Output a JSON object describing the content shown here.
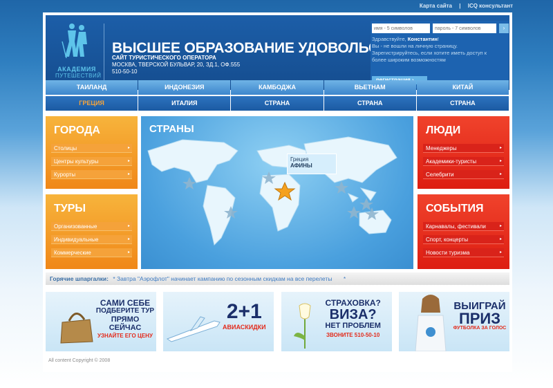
{
  "top_links": {
    "sitemap": "Карта сайта",
    "separator": "|",
    "icq": "ICQ консультант"
  },
  "logo": {
    "line1": "АКАДЕМИЯ",
    "line2": "ПУТЕШЕСТВИЙ"
  },
  "header": {
    "slogan": "ВЫСШЕЕ ОБРАЗОВАНИЕ УДОВОЛЬСТВИЙ",
    "subtitle": "САЙТ ТУРИСТИЧЕСКОГО ОПЕРАТОРА",
    "address": "МОСКВА, ТВЕРСКОЙ БУЛЬВАР, 20, ЗД.1, ОФ.555",
    "phone": "510-50-10"
  },
  "login": {
    "name_placeholder": "имя - 5 символов",
    "password_placeholder": "пароль - 7 символов",
    "go_label": "›",
    "greeting": "Здравствуйте,",
    "user": "Константин",
    "greeting_end": "!",
    "message": "Вы - не вошли на личную страницу. Зарегистрируйтесь, если хотите иметь доступ к более широким возможностям",
    "register_label": "регистрация ›"
  },
  "countries_row1": [
    "ТАИЛАНД",
    "ИНДОНЕЗИЯ",
    "КАМБОДЖА",
    "ВЬЕТНАМ",
    "КИТАЙ"
  ],
  "countries_row2": [
    "ГРЕЦИЯ",
    "ИТАЛИЯ",
    "СТРАНА",
    "СТРАНА",
    "СТРАНА"
  ],
  "cities": {
    "title": "ГОРОДА",
    "items": [
      "Столицы",
      "Центры культуры",
      "Курорты"
    ]
  },
  "tours": {
    "title": "ТУРЫ",
    "items": [
      "Организованные",
      "Индивидуальные",
      "Коммерческие"
    ]
  },
  "people": {
    "title": "ЛЮДИ",
    "items": [
      "Менеджеры",
      "Академики-туристы",
      "Селебрити"
    ]
  },
  "events": {
    "title": "СОБЫТИЯ",
    "items": [
      "Карнавалы, фестивали",
      "Спорт, концерты",
      "Новости туризма"
    ]
  },
  "item_arrow": "▸",
  "map": {
    "title": "СТРАНЫ",
    "tooltip_country": "Греция",
    "tooltip_city": "АФИНЫ"
  },
  "hot": {
    "label": "Горячие шпаргалки:",
    "text": "* Завтра \"Аэрофлот\" начинает кампанию по сезонным скидкам на все перелеты",
    "end": "*"
  },
  "promos": {
    "p1": {
      "l1": "САМИ СЕБЕ",
      "l2": "ПОДБЕРИТЕ ТУР",
      "l3": "ПРЯМО СЕЙЧАС",
      "l4": "УЗНАЙТЕ ЕГО ЦЕНУ"
    },
    "p2": {
      "big": "2+1",
      "small": "АВИАСКИДКИ"
    },
    "p3": {
      "l1": "СТРАХОВКА?",
      "l2": "ВИЗА?",
      "l3": "НЕТ ПРОБЛЕМ",
      "l4": "ЗВОНИТЕ 510-50-10"
    },
    "p4": {
      "l1": "ВЫИГРАЙ",
      "l2": "ПРИЗ",
      "l3": "ФУТБОЛКА ЗА ГОЛОС"
    }
  },
  "footer": "All content Copyright © 2008",
  "colors": {
    "orange": "#f28c1c",
    "red": "#e32a1a",
    "blue": "#1c5ea8",
    "accent_text": "#f6a43a"
  }
}
